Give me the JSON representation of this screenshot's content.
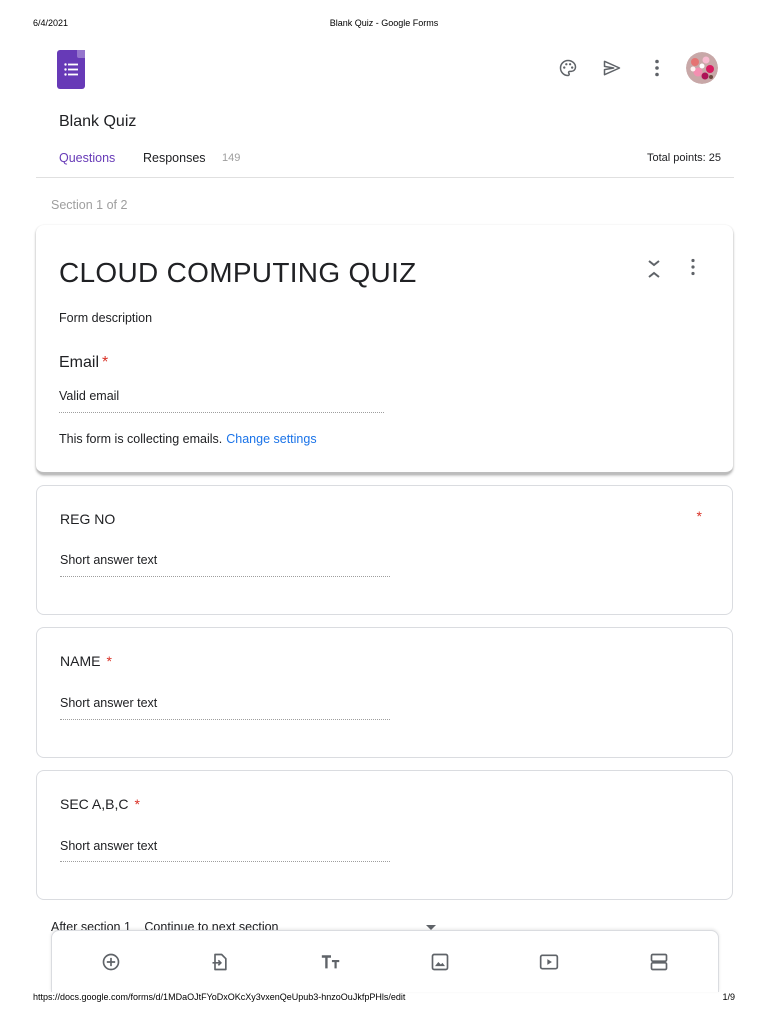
{
  "print": {
    "date": "6/4/2021",
    "page_title": "Blank Quiz - Google Forms",
    "url": "https://docs.google.com/forms/d/1MDaOJtFYoDxOKcXy3vxenQeUpub3-hnzoOuJkfpPHls/edit",
    "page_number": "1/9"
  },
  "header": {
    "icons": [
      "forms-logo-icon",
      "palette-icon",
      "send-icon",
      "more-vert-icon",
      "avatar"
    ]
  },
  "form": {
    "name": "Blank Quiz"
  },
  "tabs": {
    "questions": "Questions",
    "responses": "Responses",
    "responses_count": "149",
    "total_points": "Total points: 25"
  },
  "section": {
    "label": "Section 1 of 2"
  },
  "header_card": {
    "title": "CLOUD COMPUTING QUIZ",
    "description": "Form description",
    "email_label": "Email",
    "required_mark": "*",
    "email_placeholder": "Valid email",
    "collecting_text": "This form is collecting emails.",
    "change_settings": "Change settings"
  },
  "questions": [
    {
      "title": "REG NO",
      "answer_placeholder": "Short answer text",
      "required_mark": "*"
    },
    {
      "title": "NAME",
      "answer_placeholder": "Short answer text",
      "required_mark": "*"
    },
    {
      "title": "SEC A,B,C",
      "answer_placeholder": "Short answer text",
      "required_mark": "*"
    }
  ],
  "after_section": {
    "label": "After section 1",
    "value": "Continue to next section"
  },
  "toolbar": {
    "icons": [
      "add-question-icon",
      "import-questions-icon",
      "add-title-icon",
      "add-image-icon",
      "add-video-icon",
      "add-section-icon"
    ]
  },
  "colors": {
    "accent": "#673ab7",
    "link": "#1a73e8",
    "required": "#d93025",
    "muted": "#9e9e9e"
  }
}
